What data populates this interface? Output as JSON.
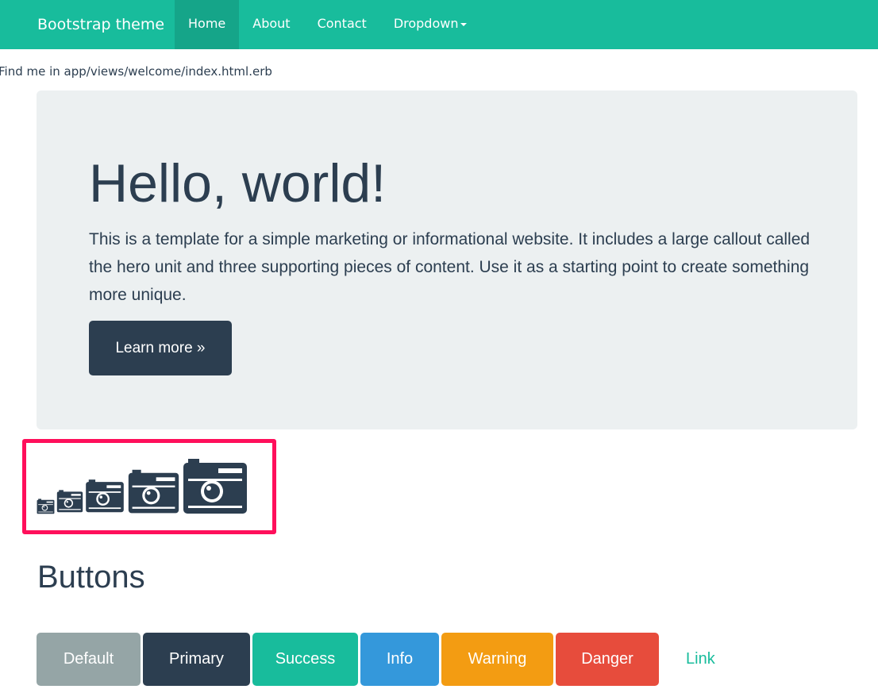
{
  "navbar": {
    "brand": "Bootstrap theme",
    "items": [
      {
        "label": "Home",
        "active": true
      },
      {
        "label": "About",
        "active": false
      },
      {
        "label": "Contact",
        "active": false
      },
      {
        "label": "Dropdown",
        "active": false
      }
    ],
    "color": "#18bc9c"
  },
  "find_text": "Find me in app/views/welcome/index.html.erb",
  "jumbotron": {
    "title": "Hello, world!",
    "lead": "This is a template for a simple marketing or informational website. It includes a large callout called the hero unit and three supporting pieces of content. Use it as a starting point to create something more unique.",
    "button_label": "Learn more »"
  },
  "icons": {
    "name": "camera-icon",
    "highlight_color": "#ff0f5b"
  },
  "buttons_section": {
    "title": "Buttons",
    "buttons": [
      {
        "label": "Default",
        "color": "#95a5a6"
      },
      {
        "label": "Primary",
        "color": "#2c3e50"
      },
      {
        "label": "Success",
        "color": "#18bc9c"
      },
      {
        "label": "Info",
        "color": "#3498db"
      },
      {
        "label": "Warning",
        "color": "#f39c12"
      },
      {
        "label": "Danger",
        "color": "#e74c3c"
      }
    ],
    "link_label": "Link"
  }
}
